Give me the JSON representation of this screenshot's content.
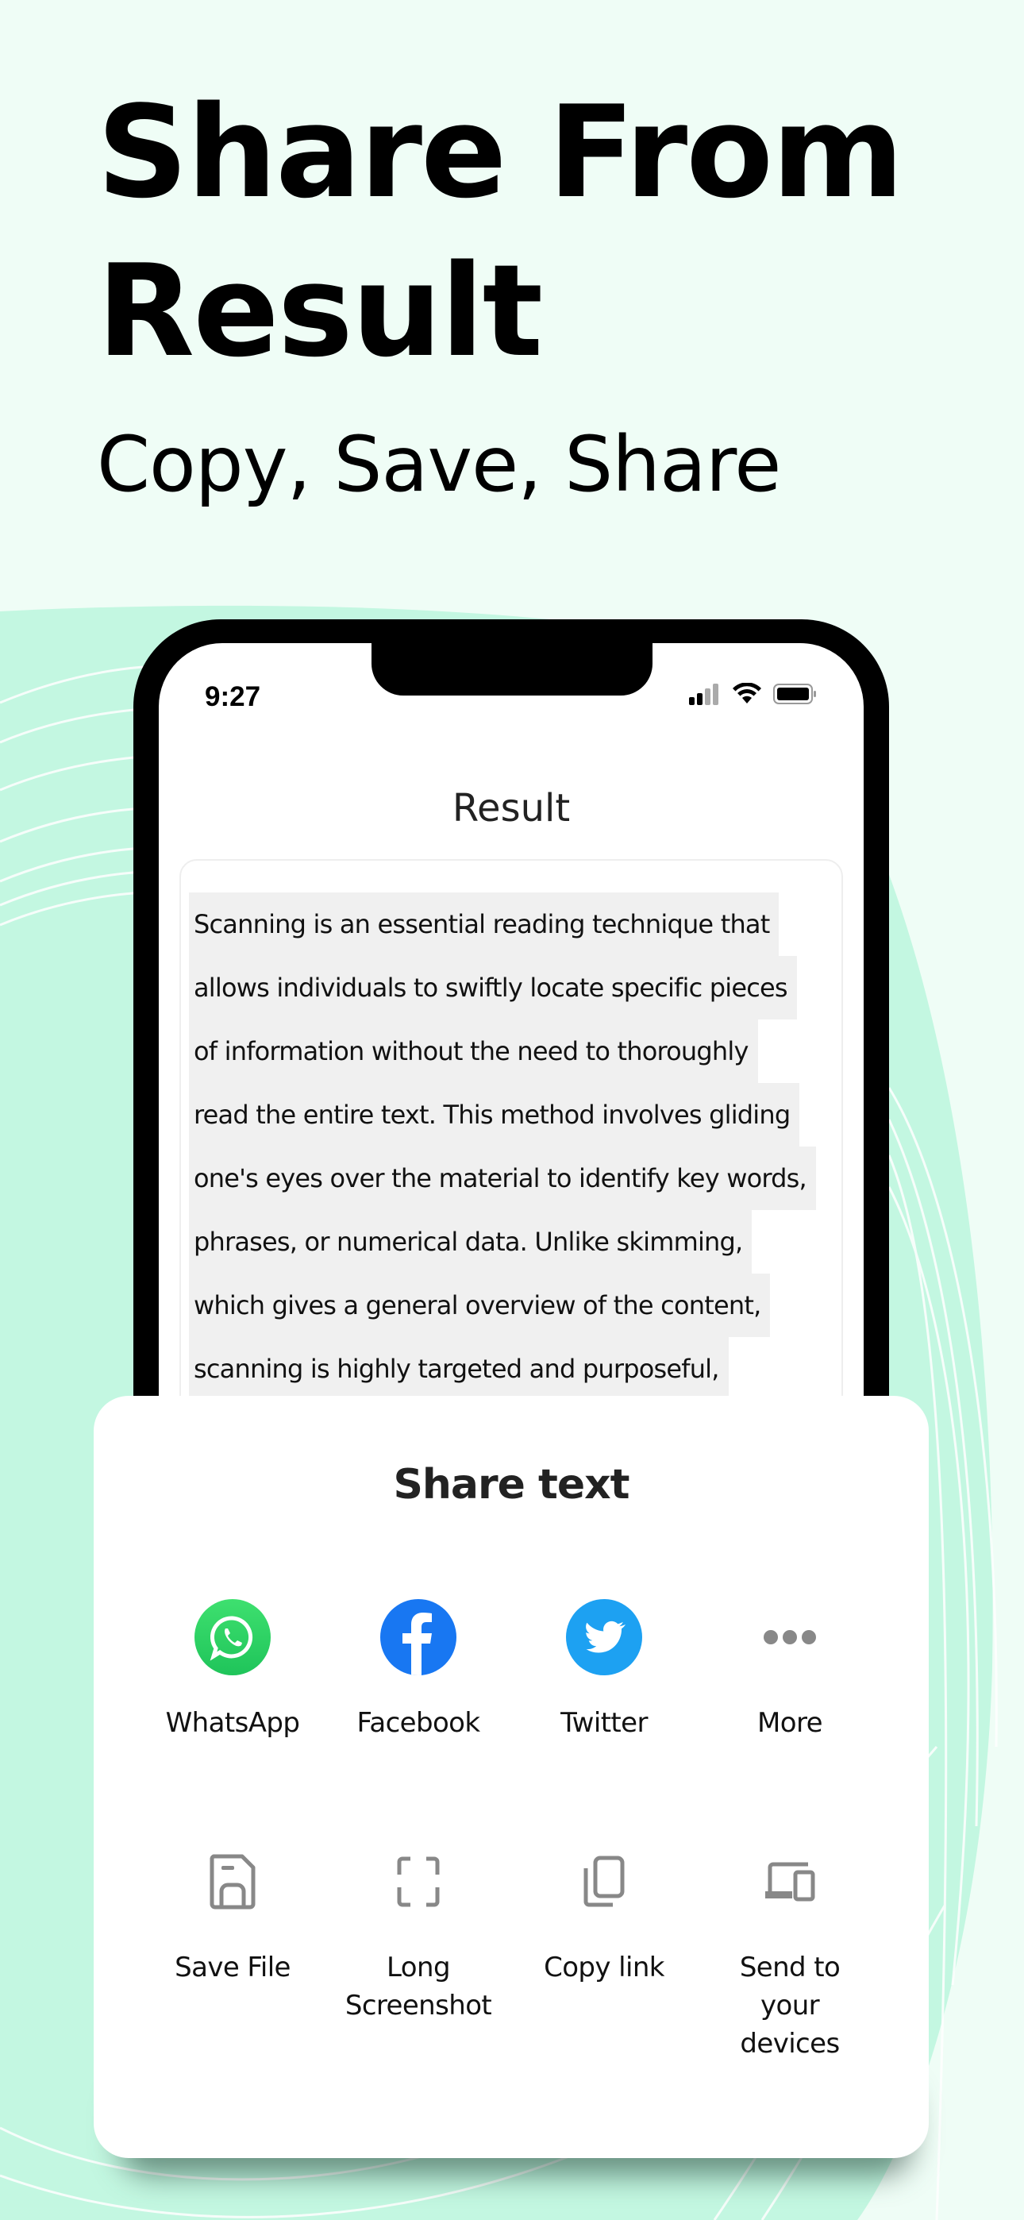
{
  "hero": {
    "title_line1": "Share From",
    "title_line2": "Result",
    "subtitle": "Copy, Save, Share"
  },
  "phone": {
    "status_bar": {
      "time": "9:27",
      "icons": [
        "cellular-signal-icon",
        "wifi-icon",
        "battery-icon"
      ]
    },
    "screen_title": "Result",
    "result_text_lines": [
      "Scanning is an essential reading technique that",
      "allows individuals to swiftly locate specific pieces",
      "of information without the need to thoroughly",
      "read the entire text. This method involves gliding",
      "one's eyes over the material to identify key words,",
      "phrases, or numerical data. Unlike skimming,",
      "which gives a general overview of the content,",
      "scanning is highly targeted and purposeful,"
    ]
  },
  "share_sheet": {
    "title": "Share text",
    "apps": [
      {
        "label": "WhatsApp",
        "icon": "whatsapp-icon",
        "color": "#25d366"
      },
      {
        "label": "Facebook",
        "icon": "facebook-icon",
        "color": "#1877f2"
      },
      {
        "label": "Twitter",
        "icon": "twitter-icon",
        "color": "#1da1f2"
      },
      {
        "label": "More",
        "icon": "more-icon",
        "color": "#888888"
      }
    ],
    "actions": [
      {
        "label_lines": [
          "Save File"
        ],
        "icon": "save-file-icon"
      },
      {
        "label_lines": [
          "Long",
          "Screenshot"
        ],
        "icon": "long-screenshot-icon"
      },
      {
        "label_lines": [
          "Copy link"
        ],
        "icon": "copy-icon"
      },
      {
        "label_lines": [
          "Send to",
          "your",
          "devices"
        ],
        "icon": "send-to-devices-icon"
      }
    ]
  },
  "colors": {
    "background": "#effdf6",
    "accent_green": "#c3f7e1",
    "icon_gray": "#888888"
  }
}
